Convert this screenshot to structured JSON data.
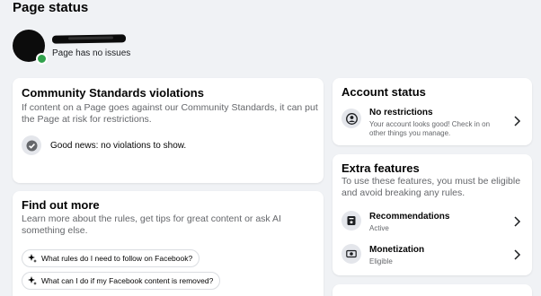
{
  "page": {
    "title": "Page status"
  },
  "profile": {
    "status_text": "Page has no issues",
    "status_color": "#31a24c"
  },
  "community": {
    "title": "Community Standards violations",
    "description_line1": "If content on a Page goes against our Community Standards, it can put",
    "description_line2": "the Page at risk for restrictions.",
    "status": "Good news: no violations to show.",
    "status_icon": "check-circle-icon"
  },
  "find_out_more": {
    "title": "Find out more",
    "description_line1": "Learn more about the rules, get tips for great content or ask AI",
    "description_line2": "something else.",
    "questions": [
      {
        "label": "What rules do I need to follow on Facebook?",
        "icon": "sparkle-icon"
      },
      {
        "label": "What can I do if my Facebook content is removed?",
        "icon": "sparkle-icon"
      }
    ]
  },
  "account_status": {
    "title": "Account status",
    "item_title": "No restrictions",
    "item_desc_line1": "Your account looks good! Check in on",
    "item_desc_line2": "other things you manage.",
    "item_icon": "account-icon"
  },
  "extra_features": {
    "title": "Extra features",
    "description_line1": "To use these features, you must be eligible",
    "description_line2": "and avoid breaking any rules.",
    "items": [
      {
        "title": "Recommendations",
        "status": "Active",
        "icon": "recommendations-icon"
      },
      {
        "title": "Monetization",
        "status": "Eligible",
        "icon": "monetization-icon"
      }
    ]
  }
}
